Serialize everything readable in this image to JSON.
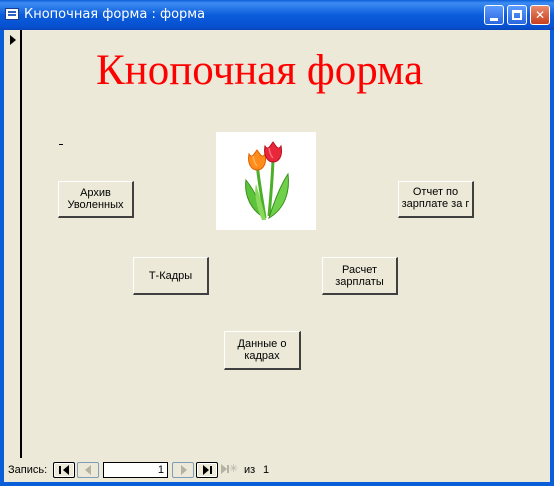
{
  "window": {
    "title": "Кнопочная форма : форма"
  },
  "form": {
    "heading": "Кнопочная форма",
    "heading_color": "#ff0000",
    "image_icon": "tulips-image"
  },
  "buttons": {
    "archive": "Архив Уволенных",
    "salary_report": "Отчет по зарплате за г",
    "tkadry": "Т-Кадры",
    "salary_calc": "Расчет зарплаты",
    "staff_data": "Данные о кадрах"
  },
  "navigation": {
    "record_label": "Запись:",
    "current_record": "1",
    "of_label": "из",
    "total_records": "1"
  }
}
